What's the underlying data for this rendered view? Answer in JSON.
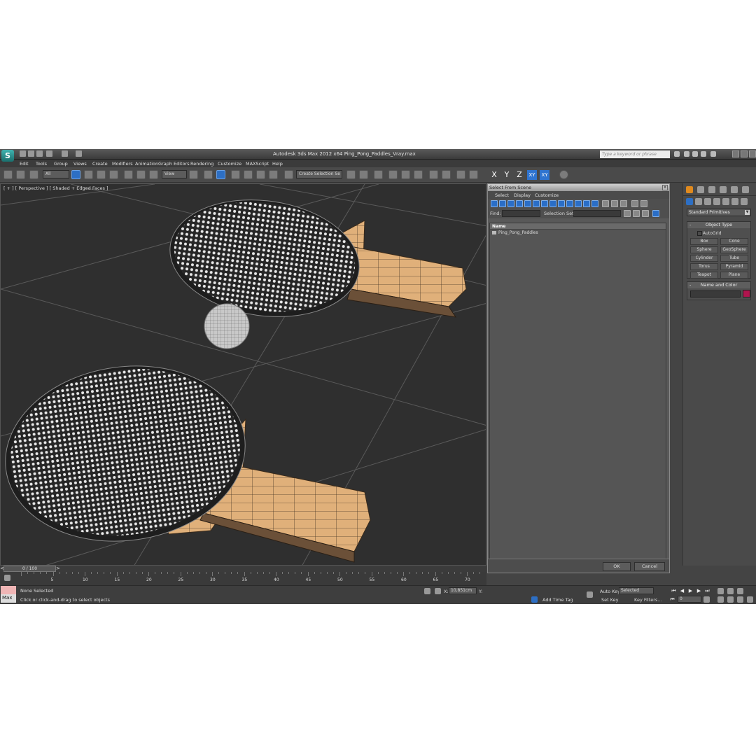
{
  "app": {
    "logo": "S",
    "title": "Autodesk 3ds Max  2012 x64     Ping_Pong_Paddles_Vray.max",
    "help_search_placeholder": "Type a keyword or phrase"
  },
  "menu": [
    "Edit",
    "Tools",
    "Group",
    "Views",
    "Create",
    "Modifiers",
    "Animation",
    "Graph Editors",
    "Rendering",
    "Customize",
    "MAXScript",
    "Help"
  ],
  "toolbar": {
    "filter_value": "All",
    "coord_value": "View",
    "selection_set_placeholder": "Create Selection Se",
    "axis_x": "X",
    "axis_y": "Y",
    "axis_z": "Z",
    "axis_xy": "XY",
    "axis_xy2": "XY"
  },
  "viewport": {
    "label": "[ + ] [ Perspective ] [ Shaded + Edged Faces ]",
    "scene_objects": [
      "ping-pong-paddle",
      "ping-pong-paddle",
      "ping-pong-ball"
    ]
  },
  "dialog": {
    "title": "Select From Scene",
    "close": "x",
    "menus": [
      "Select",
      "Display",
      "Customize"
    ],
    "find_label": "Find:",
    "selection_sets_label": "Selection Set:",
    "column_name": "Name",
    "rows": [
      "Ping_Pong_Paddles"
    ],
    "ok": "OK",
    "cancel": "Cancel"
  },
  "command_panel": {
    "category": "Standard Primitives",
    "object_type_title": "Object Type",
    "autogrid": "AutoGrid",
    "primitives": [
      "Box",
      "Cone",
      "Sphere",
      "GeoSphere",
      "Cylinder",
      "Tube",
      "Torus",
      "Pyramid",
      "Teapot",
      "Plane"
    ],
    "name_color_title": "Name and Color",
    "color": "#b0144e",
    "rollout_toggle": "-"
  },
  "timeline": {
    "frame_display": "0 / 100",
    "prev": "<",
    "next": ">",
    "ticks": [
      5,
      10,
      15,
      20,
      25,
      30,
      35,
      40,
      45,
      50,
      55,
      60,
      65,
      70
    ]
  },
  "status": {
    "maxscript_label": "Max",
    "selected": "None Selected",
    "prompt": "Click or click-and-drag to select objects",
    "x_label": "X:",
    "x_value": "10,851cm",
    "y_label": "Y:",
    "auto_key": "Auto Key",
    "selected_option": "Selected",
    "set_key": "Set Key",
    "key_filters": "Key Filters...",
    "add_time_tag": "Add Time Tag",
    "frame_value": "0"
  }
}
